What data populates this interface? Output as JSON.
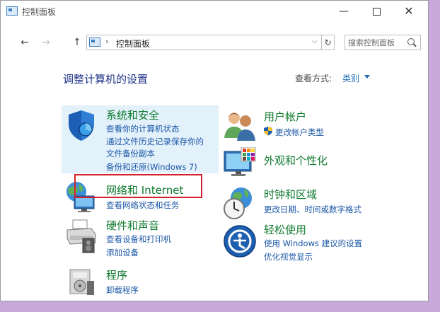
{
  "window": {
    "title": "控制面板",
    "minimize_glyph": "—",
    "close_glyph": "✕"
  },
  "nav": {
    "back_glyph": "←",
    "forward_glyph": "→",
    "up_glyph": "↑",
    "address_sep": "›",
    "address_text": "控制面板",
    "address_dropdown": "⌵",
    "refresh_glyph": "↻",
    "search_placeholder": "搜索控制面板"
  },
  "header": {
    "title": "调整计算机的设置",
    "view_by_label": "查看方式:",
    "view_by_value": "类别"
  },
  "categories": {
    "system_security": {
      "title": "系统和安全",
      "links": [
        "查看你的计算机状态",
        "通过文件历史记录保存你的",
        "文件备份副本",
        "备份和还原(Windows 7)"
      ]
    },
    "network": {
      "title": "网络和 Internet",
      "links": [
        "查看网络状态和任务"
      ]
    },
    "hardware": {
      "title": "硬件和声音",
      "links": [
        "查看设备和打印机",
        "添加设备"
      ]
    },
    "programs": {
      "title": "程序",
      "links": [
        "卸载程序"
      ]
    },
    "user_accounts": {
      "title": "用户帐户",
      "links": [
        "更改帐户类型"
      ]
    },
    "appearance": {
      "title": "外观和个性化",
      "links": []
    },
    "clock_region": {
      "title": "时钟和区域",
      "links": [
        "更改日期、时间或数字格式"
      ]
    },
    "ease_access": {
      "title": "轻松使用",
      "links": [
        "使用 Windows 建议的设置",
        "优化视觉显示"
      ]
    }
  },
  "colors": {
    "title_green": "#0f7a2e",
    "link_blue": "#1a56a6",
    "highlight_bg": "#e3f1fb",
    "annotation_red": "#d3202a"
  }
}
